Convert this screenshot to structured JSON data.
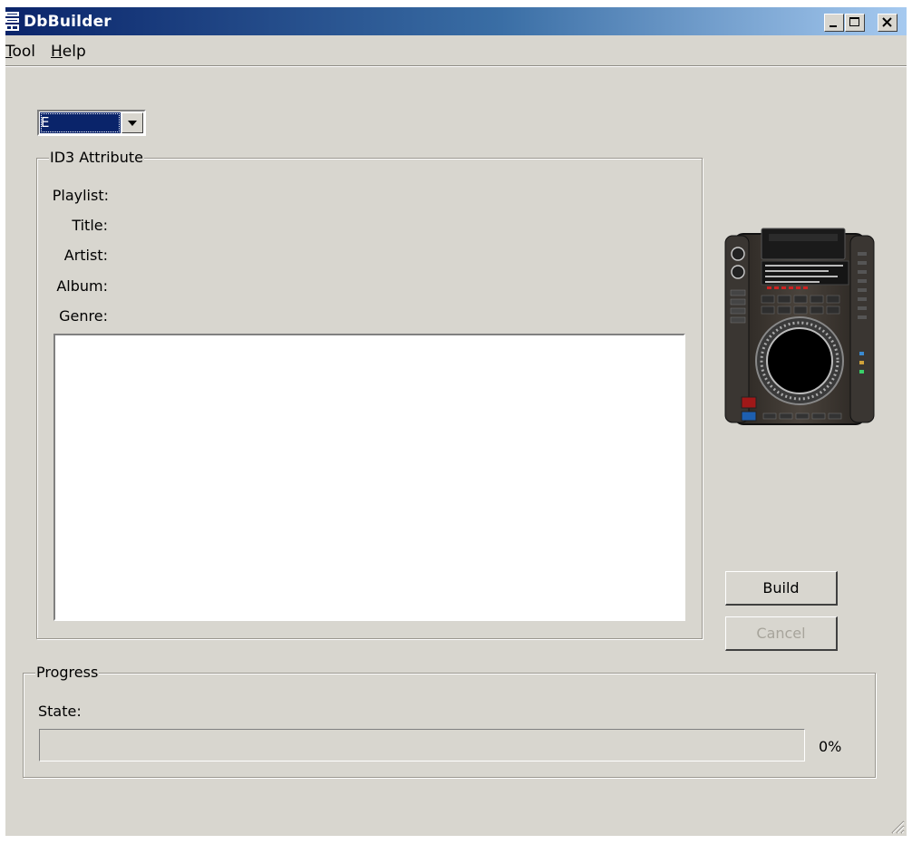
{
  "window": {
    "title": "DbBuilder",
    "icon": "db-app-icon",
    "controls": {
      "minimize": "minimize-icon",
      "maximize": "maximize-icon",
      "close": "close-icon"
    }
  },
  "menu": [
    {
      "accel": "T",
      "rest": "ool"
    },
    {
      "accel": "H",
      "rest": "elp"
    }
  ],
  "drive_select": {
    "selected": "E"
  },
  "id3": {
    "group_label": "ID3 Attribute",
    "fields": [
      {
        "label": "Playlist:",
        "value": ""
      },
      {
        "label": "Title:",
        "value": ""
      },
      {
        "label": "Artist:",
        "value": ""
      },
      {
        "label": "Album:",
        "value": ""
      },
      {
        "label": "Genre:",
        "value": ""
      }
    ]
  },
  "device_image": "cd-player-device-image",
  "buttons": {
    "build": "Build",
    "cancel": "Cancel"
  },
  "progress": {
    "group_label": "Progress",
    "state_label": "State:",
    "state_value": "",
    "fraction": 0,
    "percent_text": "0%"
  }
}
